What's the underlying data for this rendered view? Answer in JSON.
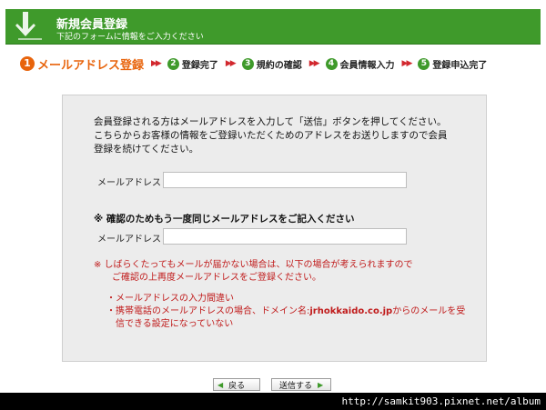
{
  "header": {
    "title": "新規会員登録",
    "subtitle": "下記のフォームに情報をご入力ください",
    "color": "#3f9a2b"
  },
  "steps": [
    {
      "num": "1",
      "label": "メールアドレス登録",
      "active": true
    },
    {
      "num": "2",
      "label": "登録完了",
      "active": false
    },
    {
      "num": "3",
      "label": "規約の確認",
      "active": false
    },
    {
      "num": "4",
      "label": "会員情報入力",
      "active": false
    },
    {
      "num": "5",
      "label": "登録申込完了",
      "active": false
    }
  ],
  "step_separator": "▶▶",
  "form": {
    "intro": "会員登録される方はメールアドレスを入力して「送信」ボタンを押してください。\nこちらからお客様の情報をご登録いただくためのアドレスをお送りしますので会員\n登録を続けてください。",
    "email_label": "メールアドレス",
    "email_value": "",
    "confirm_heading": "※ 確認のためもう一度同じメールアドレスをご記入ください",
    "confirm_label": "メールアドレス",
    "confirm_value": ""
  },
  "note": {
    "line1": "※ しばらくたってもメールが届かない場合は、以下の場合が考えられますので",
    "line2": "ご確認の上再度メールアドレスをご登録ください。",
    "bullet1": "・メールアドレスの入力間違い",
    "bullet2_pre": "・携帯電話のメールアドレスの場合、ドメイン名:",
    "bullet2_domain": "jrhokkaido.co.jp",
    "bullet2_post": "からのメールを受",
    "bullet2_cont": "信できる設定になっていない"
  },
  "buttons": {
    "back": "戻る",
    "send": "送信する"
  },
  "watermark": "http://samkit903.pixnet.net/album"
}
